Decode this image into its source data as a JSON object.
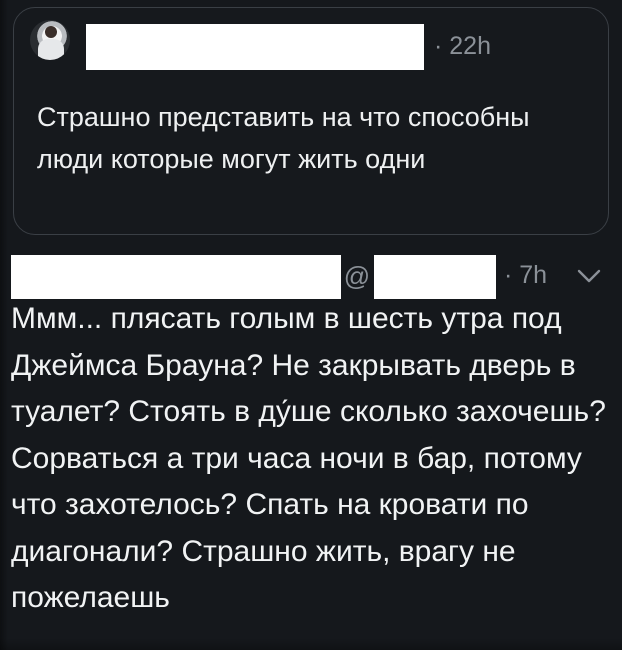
{
  "quoted_tweet": {
    "avatar_icon": "profile-photo-avatar",
    "time": "· 22h",
    "text": "Страшно представить на что способны люди которые могут жить одни"
  },
  "reply_tweet": {
    "handle_prefix": "@",
    "time": "· 7h",
    "menu_icon": "chevron-down-icon",
    "text": "Ммм... плясать голым в шесть утра под Джеймса Брауна? Не закрывать дверь в туалет? Стоять в ду́ше сколько захочешь? Сорваться а три часа ночи в бар, потому что захотелось? Спать на кровати по диагонали? Страшно жить, врагу не пожелаешь"
  },
  "colors": {
    "background": "#15181c",
    "card_border": "#3a3f45",
    "primary_text": "#e7e9ea",
    "secondary_text": "#8b9198",
    "redaction": "#ffffff"
  }
}
